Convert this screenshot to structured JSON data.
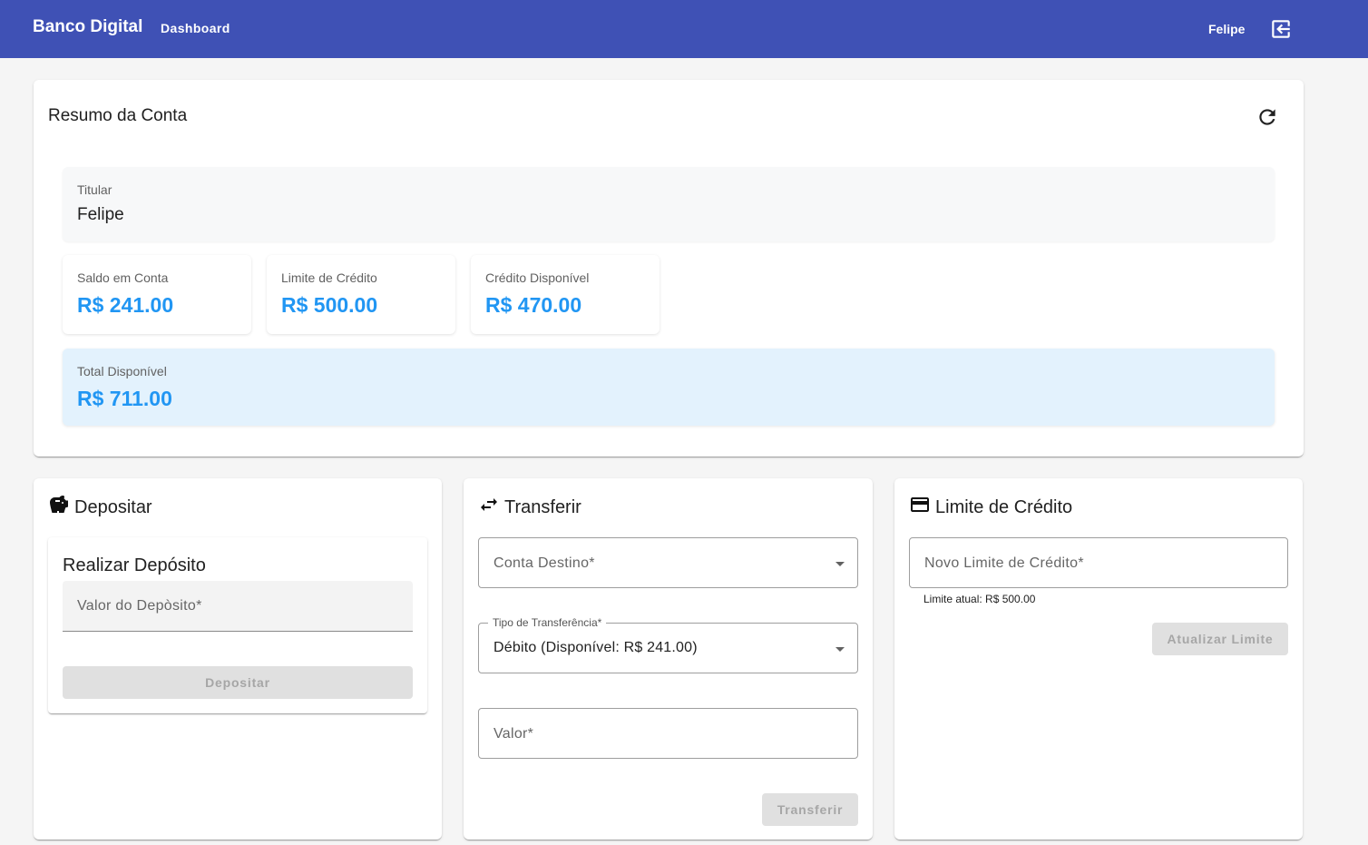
{
  "appbar": {
    "brand": "Banco Digital",
    "nav_dashboard": "Dashboard",
    "user": "Felipe",
    "logout_icon": "logout-icon"
  },
  "summary": {
    "title": "Resumo da Conta",
    "refresh_icon": "refresh-icon",
    "holder_label": "Titular",
    "holder_value": "Felipe",
    "stats": [
      {
        "label": "Saldo em Conta",
        "value": "R$ 241.00"
      },
      {
        "label": "Limite de Crédito",
        "value": "R$ 500.00"
      },
      {
        "label": "Crédito Disponível",
        "value": "R$ 470.00"
      }
    ],
    "total_label": "Total Disponível",
    "total_value": "R$ 711.00"
  },
  "deposit": {
    "title": "Depositar",
    "icon": "piggy-bank-icon",
    "inner_title": "Realizar Depósito",
    "amount_placeholder": "Valor do Depòsito*",
    "button": "Depositar"
  },
  "transfer": {
    "title": "Transferir",
    "icon": "swap-horiz-icon",
    "dest_placeholder": "Conta Destino*",
    "type_label": "Tipo de Transferência*",
    "type_value": "Débito (Disponível: R$ 241.00)",
    "amount_placeholder": "Valor*",
    "button": "Transferir"
  },
  "credit": {
    "title": "Limite de Crédito",
    "icon": "credit-card-icon",
    "new_limit_placeholder": "Novo Limite de Crédito*",
    "helper": "Limite atual: R$ 500.00",
    "button": "Atualizar Limite"
  },
  "colors": {
    "appbar": "#3f51b5",
    "accent_value": "#2196f3",
    "total_bg": "#e3f2fd"
  }
}
